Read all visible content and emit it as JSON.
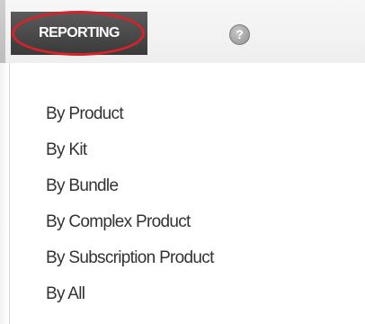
{
  "nav": {
    "reporting_label": "REPORTING",
    "help_icon": "question-circle-icon",
    "help_glyph": "?",
    "highlight_color": "#d6222a",
    "tab_color": "#4a4a4a"
  },
  "menu": {
    "items": [
      {
        "label": "By Product"
      },
      {
        "label": "By Kit"
      },
      {
        "label": "By Bundle"
      },
      {
        "label": "By Complex Product"
      },
      {
        "label": "By Subscription Product"
      },
      {
        "label": "By All"
      }
    ]
  }
}
